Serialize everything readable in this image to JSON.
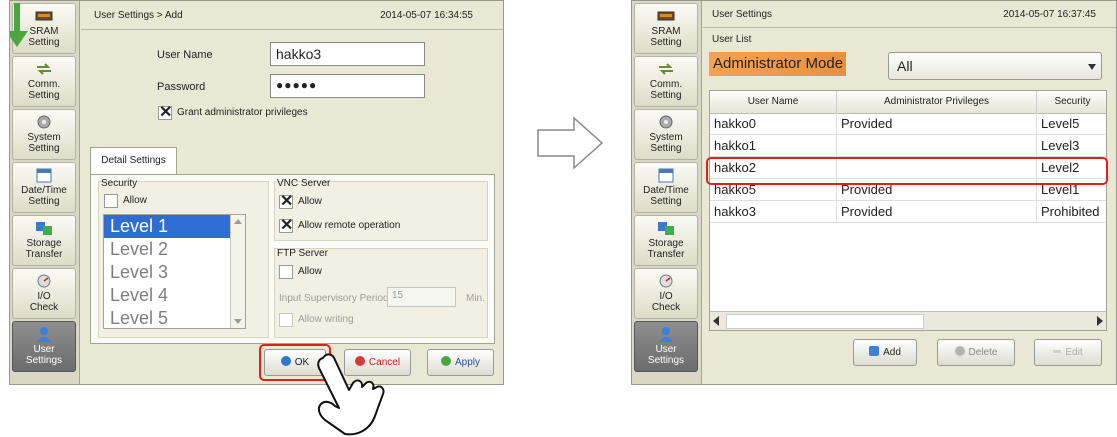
{
  "left": {
    "sidebar": [
      {
        "label1": "SRAM",
        "label2": "Setting",
        "icon": "sram-icon"
      },
      {
        "label1": "Comm.",
        "label2": "Setting",
        "icon": "comm-icon"
      },
      {
        "label1": "System",
        "label2": "Setting",
        "icon": "gear-icon"
      },
      {
        "label1": "Date/Time",
        "label2": "Setting",
        "icon": "calendar-icon"
      },
      {
        "label1": "Storage",
        "label2": "Transfer",
        "icon": "storage-icon"
      },
      {
        "label1": "I/O",
        "label2": "Check",
        "icon": "io-icon"
      },
      {
        "label1": "User",
        "label2": "Settings",
        "icon": "user-icon"
      }
    ],
    "title": "User Settings > Add",
    "time": "2014-05-07  16:34:55",
    "user_name_label": "User Name",
    "user_name_value": "hakko3",
    "password_label": "Password",
    "password_value": "●●●●●",
    "grant_admin_label": "Grant administrator privileges",
    "tab_label": "Detail Settings",
    "security_label": "Security",
    "allow_label": "Allow",
    "levels": [
      "Level 1",
      "Level 2",
      "Level 3",
      "Level 4",
      "Level 5"
    ],
    "vnc_label": "VNC Server",
    "vnc_allow": "Allow",
    "vnc_remote": "Allow remote operation",
    "ftp_label": "FTP Server",
    "ftp_allow": "Allow",
    "ftp_period_label": "Input Supervisory Period",
    "ftp_period_value": "15",
    "ftp_period_unit": "Min.",
    "ftp_writing": "Allow writing",
    "ok_label": "OK",
    "cancel_label": "Cancel",
    "apply_label": "Apply"
  },
  "right": {
    "title": "User Settings",
    "time": "2014-05-07  16:37:45",
    "user_list_label": "User List",
    "admin_mode_label": "Administrator Mode",
    "filter_value": "All",
    "columns": [
      "User Name",
      "Administrator Privileges",
      "Security"
    ],
    "rows": [
      [
        "hakko0",
        "Provided",
        "Level5"
      ],
      [
        "hakko1",
        "",
        "Level3"
      ],
      [
        "hakko2",
        "",
        "Level2"
      ],
      [
        "hakko5",
        "Provided",
        "Level1"
      ],
      [
        "hakko3",
        "Provided",
        "Prohibited"
      ]
    ],
    "add_label": "Add",
    "delete_label": "Delete",
    "edit_label": "Edit"
  },
  "colors": {
    "highlight": "#e02020",
    "selection": "#2f6cd4",
    "admin_mode_bg": "#f5a253"
  }
}
